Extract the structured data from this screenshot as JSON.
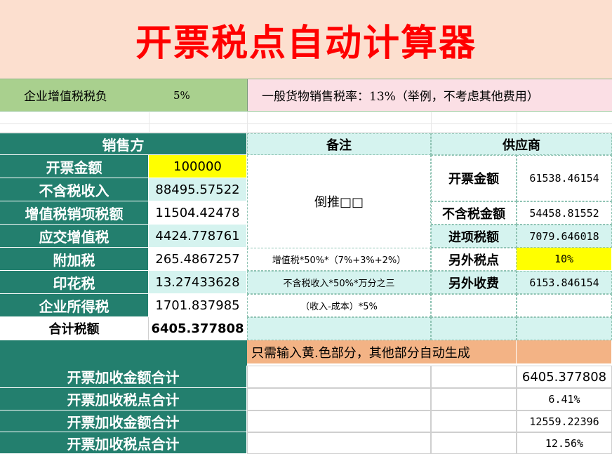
{
  "title": "开票税点自动计算器",
  "band": {
    "burden_label": "企业增值税税负",
    "burden_value": "5%",
    "note": "一般货物销售税率：13%（举例，不考虑其他费用）"
  },
  "headers": {
    "seller": "销售方",
    "remark": "备注",
    "supplier": "供应商"
  },
  "seller_rows": [
    {
      "label": "开票金额",
      "value": "100000"
    },
    {
      "label": "不含税收入",
      "value": "88495.57522"
    },
    {
      "label": "增值税销项税额",
      "value": "11504.42478"
    },
    {
      "label": "应交增值税",
      "value": "4424.778761"
    },
    {
      "label": "附加税",
      "value": "265.4867257"
    },
    {
      "label": "印花税",
      "value": "13.27433628"
    },
    {
      "label": "企业所得税",
      "value": "1701.837985"
    }
  ],
  "total": {
    "label": "合计税额",
    "value": "6405.377808"
  },
  "remarks": {
    "reverse": "倒推□□",
    "surtax": "增值税*50%*（7%+3%+2%）",
    "stamp": "不含税收入*50%*万分之三",
    "income": "（收入-成本）*5%"
  },
  "supplier_rows": [
    {
      "label": "开票金额",
      "value": "61538.46154"
    },
    {
      "label": "不含税金额",
      "value": "54458.81552"
    },
    {
      "label": "进项税额",
      "value": "7079.646018"
    },
    {
      "label": "另外税点",
      "value": "10%"
    },
    {
      "label": "另外收费",
      "value": "6153.846154"
    }
  ],
  "hint": "只需输入黄.色部分，其他部分自动生成",
  "summary": [
    {
      "label": "开票加收金额合计",
      "value": "6405.377808"
    },
    {
      "label": "开票加收税点合计",
      "value": "6.41%"
    },
    {
      "label": "开票加收金额合计",
      "value": "12559.22396"
    },
    {
      "label": "开票加收税点合计",
      "value": "12.56%"
    }
  ],
  "colors": {
    "title_bg": "#fcdfcf",
    "title_text": "#ff0000",
    "green": "#237f6e",
    "cyan": "#d5f3ef",
    "yellow": "#ffff00",
    "orange": "#f3b385",
    "burden_bg": "#a9d08e",
    "note_bg": "#fbdfe5"
  }
}
